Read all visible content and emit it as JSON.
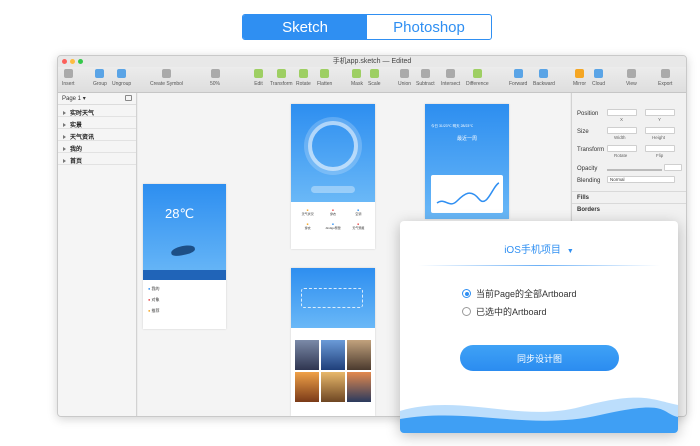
{
  "tabs": [
    "Sketch",
    "Photoshop"
  ],
  "active_tab": 0,
  "window": {
    "title": "手机app.sketch — Edited",
    "traffic_colors": [
      "#fc605b",
      "#fdbc40",
      "#34c84a"
    ]
  },
  "toolbar": [
    {
      "label": "Insert",
      "icon": "plus-icon"
    },
    {
      "label": "Group",
      "icon": "group-icon"
    },
    {
      "label": "Ungroup",
      "icon": "ungroup-icon"
    },
    {
      "label": "Create Symbol",
      "icon": "symbol-icon"
    },
    {
      "label": "50%",
      "icon": "zoom-icon"
    },
    {
      "label": "Edit",
      "icon": "edit-icon"
    },
    {
      "label": "Transform",
      "icon": "transform-icon"
    },
    {
      "label": "Rotate",
      "icon": "rotate-icon"
    },
    {
      "label": "Flatten",
      "icon": "flatten-icon"
    },
    {
      "label": "Mask",
      "icon": "mask-icon"
    },
    {
      "label": "Scale",
      "icon": "scale-icon"
    },
    {
      "label": "Union",
      "icon": "union-icon"
    },
    {
      "label": "Subtract",
      "icon": "subtract-icon"
    },
    {
      "label": "Intersect",
      "icon": "intersect-icon"
    },
    {
      "label": "Difference",
      "icon": "difference-icon"
    },
    {
      "label": "Forward",
      "icon": "forward-icon"
    },
    {
      "label": "Backward",
      "icon": "backward-icon"
    },
    {
      "label": "Mirror",
      "icon": "mirror-icon"
    },
    {
      "label": "Cloud",
      "icon": "cloud-icon"
    },
    {
      "label": "View",
      "icon": "view-icon"
    },
    {
      "label": "Export",
      "icon": "export-icon"
    }
  ],
  "page_selector": "Page 1",
  "layers": [
    "实时天气",
    "实景",
    "天气资讯",
    "我的",
    "首页"
  ],
  "inspector": {
    "position": "Position",
    "x": "X",
    "y": "Y",
    "size": "Size",
    "width": "Width",
    "height": "Height",
    "transform": "Transform",
    "rotate": "Rotate",
    "flip": "Flip",
    "opacity": "Opacity",
    "blending": "Blending",
    "blending_value": "Normal",
    "fills": "Fills",
    "borders": "Borders"
  },
  "artboards": {
    "temp": "28℃",
    "menu": [
      "我的",
      "对象",
      "推荐"
    ],
    "date_row": "今日 31/23℃   明天 28/23℃",
    "week": "最近一周",
    "grid": [
      "天气状况",
      "穿衣",
      "空调",
      "穿衣",
      "Jindigo预警",
      "天气预报"
    ]
  },
  "dialog": {
    "project": "iOS手机项目",
    "option1": "当前Page的全部Artboard",
    "option2": "已选中的Artboard",
    "sync_button": "同步设计图"
  }
}
